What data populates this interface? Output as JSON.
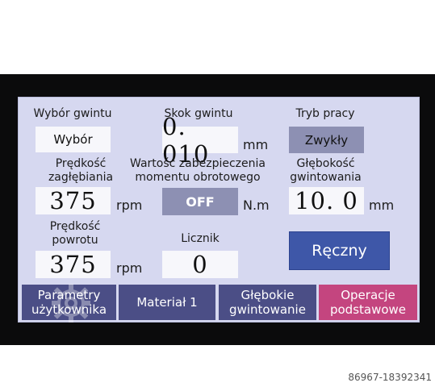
{
  "thread_selection": {
    "label": "Wybór gwintu",
    "button": "Wybór"
  },
  "thread_pitch": {
    "label": "Skok gwintu",
    "value": "0. 010",
    "unit": "mm"
  },
  "work_mode": {
    "label": "Tryb pracy",
    "value": "Zwykły"
  },
  "plunge_speed": {
    "label": "Prędkość\nzagłębiania",
    "value": "375",
    "unit": "rpm"
  },
  "torque_protection": {
    "label": "Wartość zabezpieczenia\nmomentu obrotowego",
    "value": "OFF",
    "unit": "N.m"
  },
  "tapping_depth": {
    "label": "Głębokość\ngwintowania",
    "value": "10. 0",
    "unit": "mm"
  },
  "return_speed": {
    "label": "Prędkość\npowrotu",
    "value": "375",
    "unit": "rpm"
  },
  "counter": {
    "label": "Licznik",
    "value": "0"
  },
  "manual_button": "Ręczny",
  "tabs": [
    {
      "label": "Parametry\nużytkownika"
    },
    {
      "label": "Materiał 1"
    },
    {
      "label": "Głębokie\ngwintowanie"
    },
    {
      "label": "Operacje\npodstawowe"
    }
  ],
  "colors": {
    "screen_bg": "#d6d8f0",
    "tab_blue": "#4b4e86",
    "tab_pink": "#c4457f",
    "manual_button": "#3e57a8"
  },
  "caption": "86967-18392341"
}
